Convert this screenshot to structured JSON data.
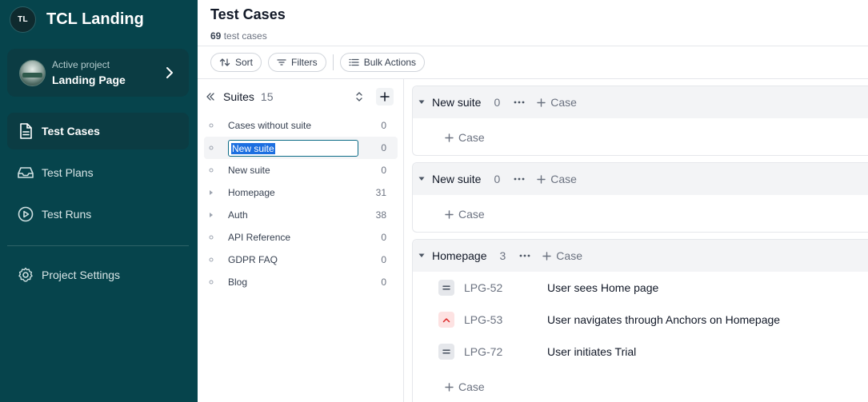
{
  "brand": {
    "initials": "TL",
    "name": "TCL Landing"
  },
  "project": {
    "caption": "Active project",
    "name": "Landing Page"
  },
  "nav": {
    "test_cases": "Test Cases",
    "test_plans": "Test Plans",
    "test_runs": "Test Runs",
    "project_settings": "Project Settings"
  },
  "header": {
    "title": "Test Cases",
    "count": "69",
    "count_suffix": " test cases"
  },
  "toolbar": {
    "sort": "Sort",
    "filters": "Filters",
    "bulk_actions": "Bulk Actions"
  },
  "suites_panel": {
    "title": "Suites",
    "count": "15",
    "rows": [
      {
        "name": "Cases without suite",
        "count": "0",
        "marker": "dot"
      },
      {
        "name": "New suite",
        "count": "0",
        "marker": "dot",
        "editing": true
      },
      {
        "name": "New suite",
        "count": "0",
        "marker": "dot"
      },
      {
        "name": "Homepage",
        "count": "31",
        "marker": "caret"
      },
      {
        "name": "Auth",
        "count": "38",
        "marker": "caret"
      },
      {
        "name": "API Reference",
        "count": "0",
        "marker": "dot"
      },
      {
        "name": "GDPR FAQ",
        "count": "0",
        "marker": "dot"
      },
      {
        "name": "Blog",
        "count": "0",
        "marker": "dot"
      }
    ]
  },
  "case_sections": [
    {
      "title": "New suite",
      "count": "0",
      "add_label": "Case",
      "cases": [],
      "footer_add": "Case"
    },
    {
      "title": "New suite",
      "count": "0",
      "add_label": "Case",
      "cases": [],
      "footer_add": "Case"
    },
    {
      "title": "Homepage",
      "count": "3",
      "add_label": "Case",
      "cases": [
        {
          "id": "LPG-52",
          "title": "User sees Home page",
          "priority": "normal"
        },
        {
          "id": "LPG-53",
          "title": "User navigates through Anchors on Homepage",
          "priority": "high"
        },
        {
          "id": "LPG-72",
          "title": "User initiates Trial",
          "priority": "normal"
        }
      ],
      "footer_add": "Case"
    }
  ],
  "colors": {
    "sidebar": "#06444c",
    "sidebar_active": "#0b3c43",
    "high_priority": "#dc2626"
  }
}
